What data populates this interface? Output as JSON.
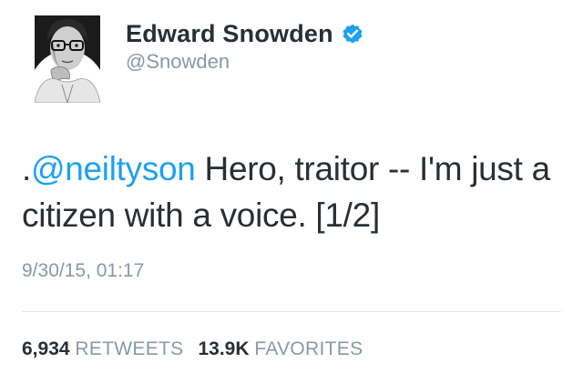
{
  "user": {
    "display_name": "Edward Snowden",
    "handle": "@Snowden",
    "verified": true
  },
  "tweet": {
    "prefix": ".",
    "mention": "@neiltyson",
    "text": " Hero, traitor -- I'm just a citizen with a voice. [1/2]",
    "timestamp": "9/30/15, 01:17"
  },
  "stats": {
    "retweets_count": "6,934",
    "retweets_label": "RETWEETS",
    "favorites_count": "13.9K",
    "favorites_label": "FAVORITES"
  },
  "colors": {
    "link": "#1da1f2",
    "verified": "#1da1f2",
    "muted": "#8899a6",
    "text": "#292f33"
  },
  "icons": {
    "verified": "verified-badge-icon"
  }
}
